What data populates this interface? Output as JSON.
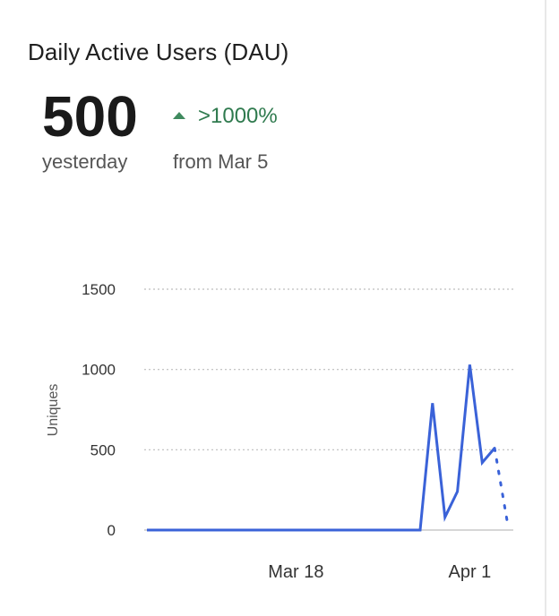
{
  "card": {
    "title": "Daily Active Users (DAU)",
    "big_value": "500",
    "big_caption": "yesterday",
    "delta_value": ">1000%",
    "delta_caption": "from Mar 5"
  },
  "colors": {
    "line": "#3a62d8",
    "delta_green": "#2f7a4e",
    "grid": "#bdbdbd"
  },
  "chart_data": {
    "type": "line",
    "title": "Daily Active Users (DAU)",
    "ylabel": "Uniques",
    "xlabel": "",
    "ylim": [
      0,
      1500
    ],
    "yticks": [
      0,
      500,
      1000,
      1500
    ],
    "ytick_labels": [
      "0",
      "500",
      "1000",
      "1500"
    ],
    "xticks": [
      {
        "x": "2024-03-18",
        "label": "Mar 18"
      },
      {
        "x": "2024-04-01",
        "label": "Apr 1"
      }
    ],
    "xlim": [
      "2024-03-06",
      "2024-04-04"
    ],
    "grid": "horizontal dotted",
    "series": [
      {
        "style": "solid",
        "x": [
          "2024-03-06",
          "2024-03-07",
          "2024-03-08",
          "2024-03-09",
          "2024-03-10",
          "2024-03-11",
          "2024-03-12",
          "2024-03-13",
          "2024-03-14",
          "2024-03-15",
          "2024-03-16",
          "2024-03-17",
          "2024-03-18",
          "2024-03-19",
          "2024-03-20",
          "2024-03-21",
          "2024-03-22",
          "2024-03-23",
          "2024-03-24",
          "2024-03-25",
          "2024-03-26",
          "2024-03-27",
          "2024-03-28",
          "2024-03-29",
          "2024-03-30",
          "2024-03-31",
          "2024-04-01",
          "2024-04-02",
          "2024-04-03"
        ],
        "values": [
          0,
          0,
          0,
          0,
          0,
          0,
          0,
          0,
          0,
          0,
          0,
          0,
          0,
          0,
          0,
          0,
          0,
          0,
          0,
          0,
          0,
          0,
          0,
          790,
          80,
          240,
          1030,
          420,
          510
        ]
      },
      {
        "style": "dotted",
        "x": [
          "2024-04-03",
          "2024-04-04"
        ],
        "values": [
          510,
          60
        ]
      }
    ]
  }
}
